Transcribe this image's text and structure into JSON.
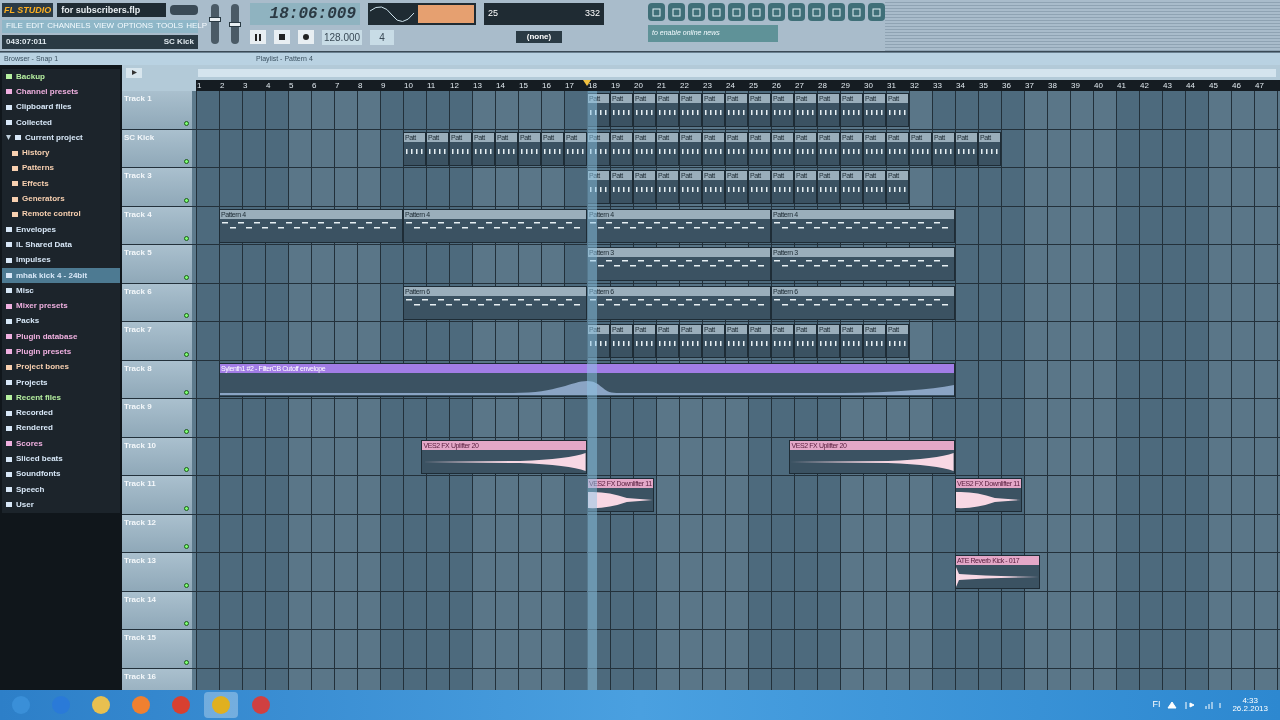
{
  "app": {
    "logo": "FL STUDIO",
    "title": "for subscribers.flp",
    "menu": [
      "FILE",
      "EDIT",
      "CHANNELS",
      "VIEW",
      "OPTIONS",
      "TOOLS",
      "HELP"
    ],
    "hint_position": "043:07:011",
    "hint_channel": "SC Kick",
    "volume": {
      "level": 0.62
    },
    "pitch": {
      "level": 0.5
    },
    "song_time": "18:06:009",
    "cpu": "25",
    "polyphony": "332",
    "tempo": "128.000",
    "beats": "4",
    "pattern_select": "(none)",
    "news": "to enable online news"
  },
  "browser": {
    "title": "Browser - Snap 1",
    "items": [
      {
        "label": "Backup",
        "color": "#b6f0a0",
        "selected": false
      },
      {
        "label": "Channel presets",
        "color": "#f0b0e0",
        "selected": false
      },
      {
        "label": "Clipboard files",
        "color": "#d8e8f8",
        "selected": false
      },
      {
        "label": "Collected",
        "color": "#d8e8f8",
        "selected": false
      },
      {
        "label": "Current project",
        "color": "#d8e8f8",
        "selected": false,
        "expanded": true,
        "children": [
          {
            "label": "History",
            "color": "#f8d0b0",
            "selected": false
          },
          {
            "label": "Patterns",
            "color": "#f8d0b0",
            "selected": false
          },
          {
            "label": "Effects",
            "color": "#f8d0b0",
            "selected": false
          },
          {
            "label": "Generators",
            "color": "#f8d0b0",
            "selected": false
          },
          {
            "label": "Remote control",
            "color": "#f8d0b0",
            "selected": false
          }
        ]
      },
      {
        "label": "Envelopes",
        "color": "#d8e8f8",
        "selected": false
      },
      {
        "label": "IL Shared Data",
        "color": "#d8e8f8",
        "selected": false
      },
      {
        "label": "Impulses",
        "color": "#d8e8f8",
        "selected": false
      },
      {
        "label": "mhak kick 4 - 24bit",
        "color": "#d8e8f8",
        "selected": true
      },
      {
        "label": "Misc",
        "color": "#d8e8f8",
        "selected": false
      },
      {
        "label": "Mixer presets",
        "color": "#f0b0e0",
        "selected": false
      },
      {
        "label": "Packs",
        "color": "#d8e8f8",
        "selected": false
      },
      {
        "label": "Plugin database",
        "color": "#f0b0e0",
        "selected": false
      },
      {
        "label": "Plugin presets",
        "color": "#f0b0e0",
        "selected": false
      },
      {
        "label": "Project bones",
        "color": "#f8d0b0",
        "selected": false
      },
      {
        "label": "Projects",
        "color": "#d8e8f8",
        "selected": false
      },
      {
        "label": "Recent files",
        "color": "#b6f0a0",
        "selected": false
      },
      {
        "label": "Recorded",
        "color": "#d8e8f8",
        "selected": false
      },
      {
        "label": "Rendered",
        "color": "#d8e8f8",
        "selected": false
      },
      {
        "label": "Scores",
        "color": "#f0b0e0",
        "selected": false
      },
      {
        "label": "Sliced beats",
        "color": "#d8e8f8",
        "selected": false
      },
      {
        "label": "Soundfonts",
        "color": "#d8e8f8",
        "selected": false
      },
      {
        "label": "Speech",
        "color": "#d8e8f8",
        "selected": false
      },
      {
        "label": "User",
        "color": "#d8e8f8",
        "selected": false
      }
    ]
  },
  "playlist": {
    "title": "Playlist - Pattern 4",
    "ruler": [
      "1",
      "2",
      "3",
      "4",
      "5",
      "6",
      "7",
      "8",
      "9",
      "10",
      "11",
      "12",
      "13",
      "14",
      "15",
      "16",
      "17",
      "18",
      "19",
      "20",
      "21",
      "22",
      "23",
      "24",
      "25",
      "26",
      "27",
      "28",
      "29",
      "30",
      "31",
      "32",
      "33",
      "34",
      "35",
      "36",
      "37",
      "38",
      "39",
      "40",
      "41",
      "42",
      "43",
      "44",
      "45",
      "46",
      "47"
    ],
    "tracks": [
      {
        "name": "Track 1",
        "enabled": true,
        "clips": [
          {
            "kind": "pattern",
            "label": "Patt"
          },
          {
            "kind": "pattern",
            "label": "Patt"
          },
          {
            "kind": "pattern",
            "label": "Patt"
          },
          {
            "kind": "pattern",
            "label": "Patt"
          },
          {
            "kind": "pattern",
            "label": "Patt"
          },
          {
            "kind": "pattern",
            "label": "Patt"
          },
          {
            "kind": "pattern",
            "label": "Patt"
          },
          {
            "kind": "pattern",
            "label": "Patt"
          },
          {
            "kind": "pattern",
            "label": "Patt"
          },
          {
            "kind": "pattern",
            "label": "Patt"
          },
          {
            "kind": "pattern",
            "label": "Patt"
          },
          {
            "kind": "pattern",
            "label": "Patt"
          },
          {
            "kind": "pattern",
            "label": "Patt"
          },
          {
            "kind": "pattern",
            "label": "Patt"
          }
        ]
      },
      {
        "name": "SC Kick",
        "enabled": true,
        "clips": [
          {
            "kind": "pattern",
            "label": "Patt"
          },
          {
            "kind": "pattern",
            "label": "Patt"
          },
          {
            "kind": "pattern",
            "label": "Patt"
          },
          {
            "kind": "pattern",
            "label": "Patt"
          },
          {
            "kind": "pattern",
            "label": "Patt"
          },
          {
            "kind": "pattern",
            "label": "Patt"
          },
          {
            "kind": "pattern",
            "label": "Patt"
          },
          {
            "kind": "pattern",
            "label": "Patt"
          },
          {
            "kind": "pattern",
            "label": "Patt"
          },
          {
            "kind": "pattern",
            "label": "Patt"
          },
          {
            "kind": "pattern",
            "label": "Patt"
          },
          {
            "kind": "pattern",
            "label": "Patt"
          },
          {
            "kind": "pattern",
            "label": "Patt"
          },
          {
            "kind": "pattern",
            "label": "Patt"
          },
          {
            "kind": "pattern",
            "label": "Patt"
          },
          {
            "kind": "pattern",
            "label": "Patt"
          },
          {
            "kind": "pattern",
            "label": "Patt"
          },
          {
            "kind": "pattern",
            "label": "Patt"
          },
          {
            "kind": "pattern",
            "label": "Patt"
          },
          {
            "kind": "pattern",
            "label": "Patt"
          },
          {
            "kind": "pattern",
            "label": "Patt"
          },
          {
            "kind": "pattern",
            "label": "Patt"
          },
          {
            "kind": "pattern",
            "label": "Patt"
          },
          {
            "kind": "pattern",
            "label": "Patt"
          },
          {
            "kind": "pattern",
            "label": "Patt"
          },
          {
            "kind": "pattern",
            "label": "Patt"
          }
        ]
      },
      {
        "name": "Track 3",
        "enabled": true,
        "clips": [
          {
            "kind": "pattern",
            "label": "Patt"
          },
          {
            "kind": "pattern",
            "label": "Patt"
          },
          {
            "kind": "pattern",
            "label": "Patt"
          },
          {
            "kind": "pattern",
            "label": "Patt"
          },
          {
            "kind": "pattern",
            "label": "Patt"
          },
          {
            "kind": "pattern",
            "label": "Patt"
          },
          {
            "kind": "pattern",
            "label": "Patt"
          },
          {
            "kind": "pattern",
            "label": "Patt"
          },
          {
            "kind": "pattern",
            "label": "Patt"
          },
          {
            "kind": "pattern",
            "label": "Patt"
          },
          {
            "kind": "pattern",
            "label": "Patt"
          },
          {
            "kind": "pattern",
            "label": "Patt"
          },
          {
            "kind": "pattern",
            "label": "Patt"
          },
          {
            "kind": "pattern",
            "label": "Patt"
          }
        ]
      },
      {
        "name": "Track 4",
        "enabled": true,
        "clips": [
          {
            "kind": "pattern",
            "label": "Pattern 4"
          },
          {
            "kind": "pattern",
            "label": "Pattern 4"
          },
          {
            "kind": "pattern",
            "label": "Pattern 4"
          },
          {
            "kind": "pattern",
            "label": "Pattern 4"
          }
        ]
      },
      {
        "name": "Track 5",
        "enabled": true,
        "clips": [
          {
            "kind": "pattern",
            "label": "Pattern 3"
          },
          {
            "kind": "pattern",
            "label": "Pattern 3"
          }
        ]
      },
      {
        "name": "Track 6",
        "enabled": true,
        "clips": [
          {
            "kind": "pattern",
            "label": "Pattern 6"
          },
          {
            "kind": "pattern",
            "label": "Pattern 6"
          },
          {
            "kind": "pattern",
            "label": "Pattern 6"
          }
        ]
      },
      {
        "name": "Track 7",
        "enabled": true,
        "clips": [
          {
            "kind": "pattern",
            "label": "Patt"
          },
          {
            "kind": "pattern",
            "label": "Patt"
          },
          {
            "kind": "pattern",
            "label": "Patt"
          },
          {
            "kind": "pattern",
            "label": "Patt"
          },
          {
            "kind": "pattern",
            "label": "Patt"
          },
          {
            "kind": "pattern",
            "label": "Patt"
          },
          {
            "kind": "pattern",
            "label": "Patt"
          },
          {
            "kind": "pattern",
            "label": "Patt"
          },
          {
            "kind": "pattern",
            "label": "Patt"
          },
          {
            "kind": "pattern",
            "label": "Patt"
          },
          {
            "kind": "pattern",
            "label": "Patt"
          },
          {
            "kind": "pattern",
            "label": "Patt"
          },
          {
            "kind": "pattern",
            "label": "Patt"
          },
          {
            "kind": "pattern",
            "label": "Patt"
          }
        ]
      },
      {
        "name": "Track 8",
        "enabled": true,
        "clips": [
          {
            "kind": "automation",
            "label": "Sylenth1 #2 - FilterCB Cutoff envelope"
          }
        ]
      },
      {
        "name": "Track 9",
        "enabled": true
      },
      {
        "name": "Track 10",
        "enabled": true,
        "clips": [
          {
            "kind": "riser",
            "label": "VES2 FX Uplifter 20"
          },
          {
            "kind": "riser",
            "label": "VES2 FX Uplifter 20"
          }
        ]
      },
      {
        "name": "Track 11",
        "enabled": true,
        "clips": [
          {
            "kind": "faller",
            "label": "VES2 FX Downlifter 11"
          },
          {
            "kind": "faller",
            "label": "VES2 FX Downlifter 11"
          }
        ]
      },
      {
        "name": "Track 12",
        "enabled": true
      },
      {
        "name": "Track 13",
        "enabled": true,
        "clips": [
          {
            "kind": "hit",
            "label": "ATE Reverb Kick - 017"
          }
        ]
      },
      {
        "name": "Track 14",
        "enabled": true
      },
      {
        "name": "Track 15",
        "enabled": true
      },
      {
        "name": "Track 16"
      }
    ]
  },
  "taskbar": {
    "language": "FI",
    "time": "4:33",
    "date": "26.2.2013"
  }
}
